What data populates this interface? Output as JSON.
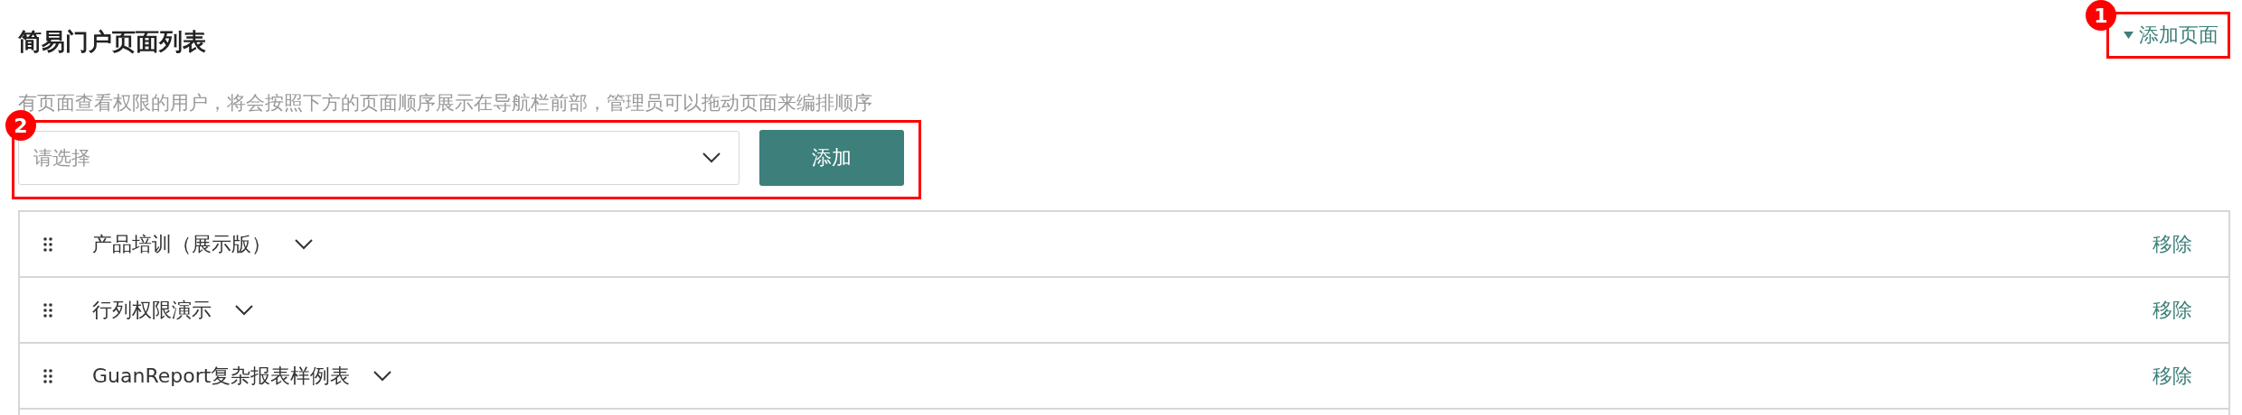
{
  "header": {
    "title": "简易门户页面列表",
    "add_page": {
      "label": "添加页面",
      "callout": "1"
    }
  },
  "description": "有页面查看权限的用户，将会按照下方的页面顺序展示在导航栏前部，管理员可以拖动页面来编排顺序",
  "picker": {
    "placeholder": "请选择",
    "button": "添加",
    "callout": "2"
  },
  "pages": [
    {
      "name": "产品培训（展示版）",
      "action": "移除"
    },
    {
      "name": "行列权限演示",
      "action": "移除"
    },
    {
      "name": "GuanReport复杂报表样例表",
      "action": "移除"
    }
  ]
}
